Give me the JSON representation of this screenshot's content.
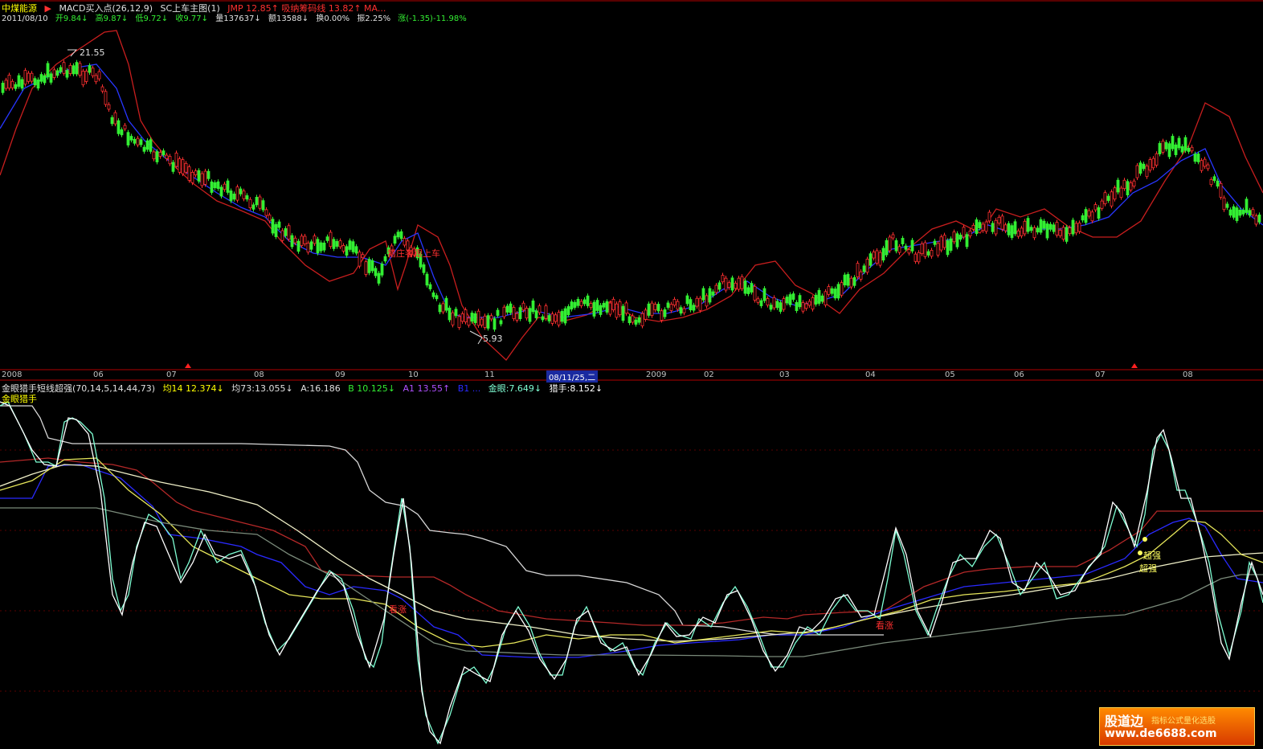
{
  "header": {
    "stock_name": "中煤能源",
    "arrow": "▶",
    "indicator": "MACD买入点(26,12,9)",
    "main_chart": "SC上车主图(1)",
    "extra": "JMP 12.85↑ 吸纳筹码线 13.82↑ MA..."
  },
  "info": {
    "date": "2011/08/10",
    "open": "开9.84↓",
    "high": "高9.87↓",
    "low": "低9.72↓",
    "close": "收9.77↓",
    "volume": "量137637↓",
    "amount": "额13588↓",
    "turnover": "换0.00%",
    "amplitude": "振2.25%",
    "change": "涨(-1.35)-11.98%"
  },
  "price_labels": {
    "high_mark": "21.55",
    "low_mark": "5.93",
    "signal": "猎庄者跟上车"
  },
  "axis": {
    "labels": [
      "2008",
      "06",
      "07",
      "08",
      "09",
      "10",
      "11",
      "08/11/25,二",
      "2009",
      "02",
      "03",
      "04",
      "05",
      "06",
      "07",
      "08"
    ],
    "highlight": "08/11/25,二"
  },
  "lower_header": {
    "name": "金眼猎手短线超强(70,14,5,14,44,73)",
    "avg14": "均14 12.374↓",
    "avg73": "均73:13.055↓",
    "a": "A:16.186",
    "b": "B 10.125↓",
    "a1": "A1 13.55↑",
    "b1": "B1 ...",
    "golden_eye": "金眼:7.649↓",
    "hunter": "猎手:8.152↓",
    "title": "金眼猎手"
  },
  "signals": {
    "buy1": "看涨",
    "buy2": "看涨",
    "strong1": "超强",
    "strong2": "超强"
  },
  "watermark": {
    "brand": "股道边",
    "slogan": "指标公式量化选股",
    "url": "www.de6688.com"
  },
  "colors": {
    "up": "#ff3030",
    "down": "#00e6e6",
    "green": "#33ee33",
    "red_line": "#c81e1e",
    "blue_line": "#1e28ff",
    "white_line": "#e8e8e8",
    "yellow": "#ffff00",
    "background": "#000000"
  }
}
